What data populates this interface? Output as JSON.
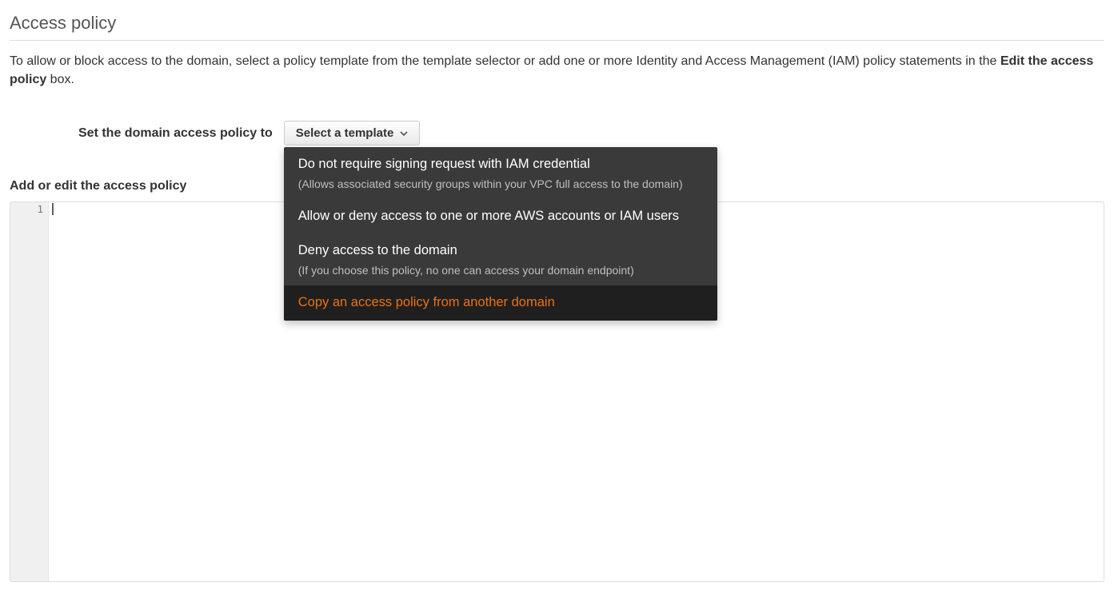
{
  "header": {
    "title": "Access policy"
  },
  "description": {
    "prefix": "To allow or block access to the domain, select a policy template from the template selector or add one or more Identity and Access Management (IAM) policy statements in the ",
    "bold": "Edit the access policy",
    "suffix": " box."
  },
  "policy_selector": {
    "label": "Set the domain access policy to",
    "button_label": "Select a template",
    "options": [
      {
        "title": "Do not require signing request with IAM credential",
        "subtitle": "(Allows associated security groups within your VPC full access to the domain)",
        "highlight": false
      },
      {
        "title": "Allow or deny access to one or more AWS accounts or IAM users",
        "subtitle": "",
        "highlight": false
      },
      {
        "title": "Deny access to the domain",
        "subtitle": "(If you choose this policy, no one can access your domain endpoint)",
        "highlight": false
      },
      {
        "title": "Copy an access policy from another domain",
        "subtitle": "",
        "highlight": true
      }
    ]
  },
  "editor": {
    "heading": "Add or edit the access policy",
    "line_number": "1",
    "content": ""
  }
}
